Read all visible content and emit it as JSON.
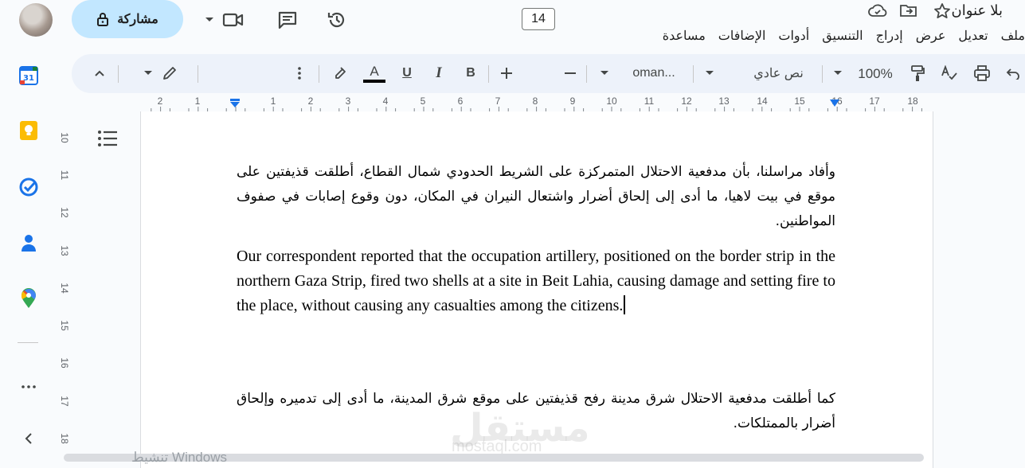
{
  "header": {
    "doc_title": "بلا عنوان",
    "share_label": "مشاركة",
    "menu": [
      "ملف",
      "تعديل",
      "عرض",
      "إدراج",
      "التنسيق",
      "أدوات",
      "الإضافات",
      "مساعدة"
    ]
  },
  "toolbar": {
    "zoom": "100%",
    "style": "نص عادي",
    "font": "oman...",
    "font_size": "14",
    "bold": "B",
    "italic": "I",
    "underline": "U",
    "text_color": "A"
  },
  "ruler": {
    "labels": [
      "2",
      "1",
      "1",
      "2",
      "3",
      "4",
      "5",
      "6",
      "7",
      "8",
      "9",
      "10",
      "11",
      "12",
      "13",
      "14",
      "15",
      "16",
      "17",
      "18"
    ],
    "vertical_labels": [
      "10",
      "11",
      "12",
      "13",
      "14",
      "15",
      "16",
      "17",
      "18"
    ]
  },
  "document": {
    "p1": "وأفاد مراسلنا، بأن مدفعية الاحتلال المتمركزة على الشريط الحدودي شمال القطاع، أطلقت قذيفتين على موقع في بيت لاهيا، ما أدى إلى إلحاق أضرار واشتعال النيران في المكان، دون وقوع إصابات في صفوف المواطنين.",
    "p2": "Our correspondent reported that the occupation artillery, positioned on the border strip in the northern Gaza Strip, fired two shells at a site in Beit Lahia, causing damage and setting fire to the place, without causing any casualties among the citizens.",
    "p3": "كما أطلقت مدفعية الاحتلال شرق مدينة رفح قذيفتين على موقع شرق المدينة، ما أدى إلى تدميره وإلحاق أضرار بالممتلكات."
  },
  "overlay": {
    "windows_watermark": "تنشيط Windows",
    "brand": "مستقل",
    "brand_url": "mostaql.com"
  },
  "colors": {
    "share_bg": "#c2e7ff",
    "toolbar_bg": "#edf2fa",
    "accent": "#1a73e8"
  }
}
